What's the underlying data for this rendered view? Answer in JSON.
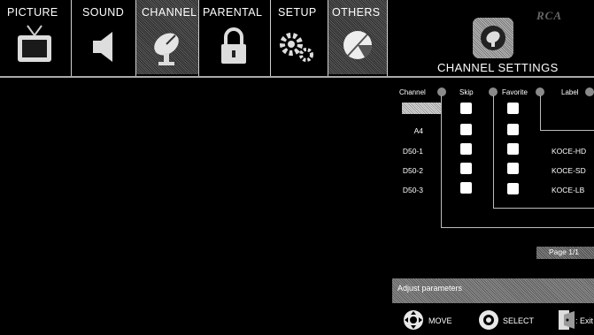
{
  "menu": {
    "tabs": [
      {
        "label": "PICTURE",
        "icon": "tv-icon",
        "selected": false
      },
      {
        "label": "SOUND",
        "icon": "speaker-icon",
        "selected": false
      },
      {
        "label": "CHANNEL",
        "icon": "satellite-dish-icon",
        "selected": true
      },
      {
        "label": "PARENTAL",
        "icon": "padlock-icon",
        "selected": false
      },
      {
        "label": "SETUP",
        "icon": "gears-icon",
        "selected": false
      },
      {
        "label": "OTHERS",
        "icon": "disc-icon",
        "selected": false
      }
    ]
  },
  "brand": "RCA",
  "section": {
    "title": "CHANNEL SETTINGS",
    "icon": "channel-settings-icon"
  },
  "table": {
    "columns": [
      "Channel",
      "Skip",
      "Favorite",
      "Label"
    ],
    "rows": [
      {
        "channel": "",
        "skip": true,
        "favorite": true,
        "label": "",
        "selected": true
      },
      {
        "channel": "A4",
        "skip": true,
        "favorite": true,
        "label": ""
      },
      {
        "channel": "D50-1",
        "skip": true,
        "favorite": true,
        "label": "KOCE-HD"
      },
      {
        "channel": "D50-2",
        "skip": true,
        "favorite": true,
        "label": "KOCE-SD"
      },
      {
        "channel": "D50-3",
        "skip": true,
        "favorite": true,
        "label": "KOCE-LB"
      }
    ]
  },
  "pager": "Page 1/1",
  "hint": "Adjust parameters",
  "footer": {
    "move": "MOVE",
    "select": "SELECT",
    "exit": ": Exit"
  },
  "colors": {
    "background": "#000000",
    "text": "#ffffff",
    "panel_gray": "#6e6e6e"
  }
}
